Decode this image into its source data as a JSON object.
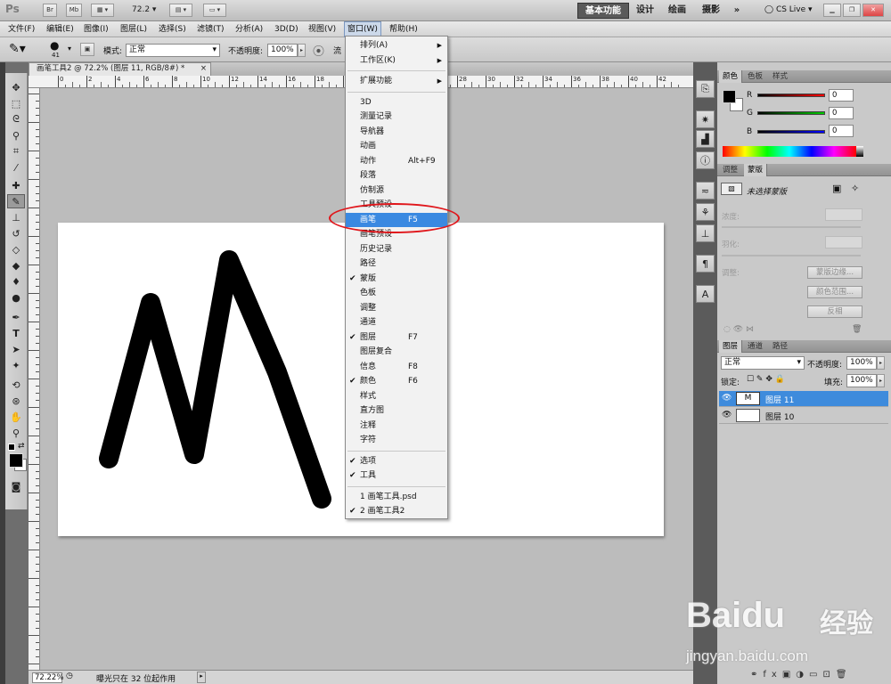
{
  "app": {
    "logo": "Ps",
    "zoom_display": "72.2",
    "statusbar_zoom": "72.22%",
    "status_text": "曝光只在 32 位起作用"
  },
  "topbar": {
    "small_buttons": [
      "Br",
      "Mb"
    ],
    "workspace_active": "基本功能",
    "workspaces": [
      "设计",
      "绘画",
      "摄影"
    ],
    "more": "»",
    "cslive": "CS Live"
  },
  "menubar": {
    "items": [
      "文件(F)",
      "编辑(E)",
      "图像(I)",
      "图层(L)",
      "选择(S)",
      "滤镜(T)",
      "分析(A)",
      "3D(D)",
      "视图(V)",
      "窗口(W)",
      "帮助(H)"
    ],
    "active": "窗口(W)"
  },
  "options": {
    "brush_size": "41",
    "mode_label": "模式:",
    "mode_value": "正常",
    "opacity_label": "不透明度:",
    "opacity_value": "100%",
    "flow_label": "流"
  },
  "document": {
    "tab_title": "画笔工具2 @ 72.2% (图层 11, RGB/8#) *",
    "ruler_numbers": [
      "0",
      "2",
      "4",
      "6",
      "8",
      "10",
      "12",
      "14",
      "16",
      "18",
      "20",
      "22",
      "24",
      "26",
      "28",
      "30",
      "32",
      "34",
      "36",
      "38",
      "40",
      "42"
    ]
  },
  "window_menu": {
    "items": [
      {
        "label": "排列(A)",
        "shortcut": "",
        "submenu": true,
        "checked": false
      },
      {
        "label": "工作区(K)",
        "shortcut": "",
        "submenu": true,
        "checked": false
      },
      {
        "sep": true
      },
      {
        "label": "扩展功能",
        "shortcut": "",
        "submenu": true,
        "checked": false
      },
      {
        "sep": true
      },
      {
        "label": "3D",
        "shortcut": "",
        "checked": false
      },
      {
        "label": "测量记录",
        "shortcut": "",
        "checked": false
      },
      {
        "label": "导航器",
        "shortcut": "",
        "checked": false
      },
      {
        "label": "动画",
        "shortcut": "",
        "checked": false
      },
      {
        "label": "动作",
        "shortcut": "Alt+F9",
        "checked": false
      },
      {
        "label": "段落",
        "shortcut": "",
        "checked": false
      },
      {
        "label": "仿制源",
        "shortcut": "",
        "checked": false
      },
      {
        "label": "工具预设",
        "shortcut": "",
        "checked": false
      },
      {
        "label": "画笔",
        "shortcut": "F5",
        "checked": false,
        "highlight": true
      },
      {
        "label": "画笔预设",
        "shortcut": "",
        "checked": false
      },
      {
        "label": "历史记录",
        "shortcut": "",
        "checked": false
      },
      {
        "label": "路径",
        "shortcut": "",
        "checked": false
      },
      {
        "label": "蒙版",
        "shortcut": "",
        "checked": true
      },
      {
        "label": "色板",
        "shortcut": "",
        "checked": false
      },
      {
        "label": "调整",
        "shortcut": "",
        "checked": false
      },
      {
        "label": "通道",
        "shortcut": "",
        "checked": false
      },
      {
        "label": "图层",
        "shortcut": "F7",
        "checked": true
      },
      {
        "label": "图层复合",
        "shortcut": "",
        "checked": false
      },
      {
        "label": "信息",
        "shortcut": "F8",
        "checked": false
      },
      {
        "label": "颜色",
        "shortcut": "F6",
        "checked": true
      },
      {
        "label": "样式",
        "shortcut": "",
        "checked": false
      },
      {
        "label": "直方图",
        "shortcut": "",
        "checked": false
      },
      {
        "label": "注释",
        "shortcut": "",
        "checked": false
      },
      {
        "label": "字符",
        "shortcut": "",
        "checked": false
      },
      {
        "sep": true
      },
      {
        "label": "选项",
        "shortcut": "",
        "checked": true
      },
      {
        "label": "工具",
        "shortcut": "",
        "checked": true
      },
      {
        "sep": true
      },
      {
        "label": "1 画笔工具.psd",
        "shortcut": "",
        "checked": false
      },
      {
        "label": "2 画笔工具2",
        "shortcut": "",
        "checked": true
      }
    ]
  },
  "color_panel": {
    "tabs": [
      "颜色",
      "色板",
      "样式"
    ],
    "r_label": "R",
    "g_label": "G",
    "b_label": "B",
    "r": "0",
    "g": "0",
    "b": "0"
  },
  "masks_panel": {
    "tabs": [
      "调整",
      "蒙版"
    ],
    "title": "未选择蒙版",
    "density_label": "浓度:",
    "feather_label": "羽化:",
    "refine_label": "调整:",
    "btn_edge": "蒙版边缘...",
    "btn_range": "颜色范围...",
    "btn_invert": "反相"
  },
  "layers_panel": {
    "tabs": [
      "图层",
      "通道",
      "路径"
    ],
    "blend_mode": "正常",
    "opacity_label": "不透明度:",
    "opacity_value": "100%",
    "lock_label": "锁定:",
    "fill_label": "填充:",
    "fill_value": "100%",
    "layers": [
      {
        "name": "图层 11",
        "selected": true
      },
      {
        "name": "图层 10",
        "selected": false
      }
    ]
  },
  "watermark": {
    "brand": "Baidu",
    "cn": "经验",
    "url": "jingyan.baidu.com"
  }
}
